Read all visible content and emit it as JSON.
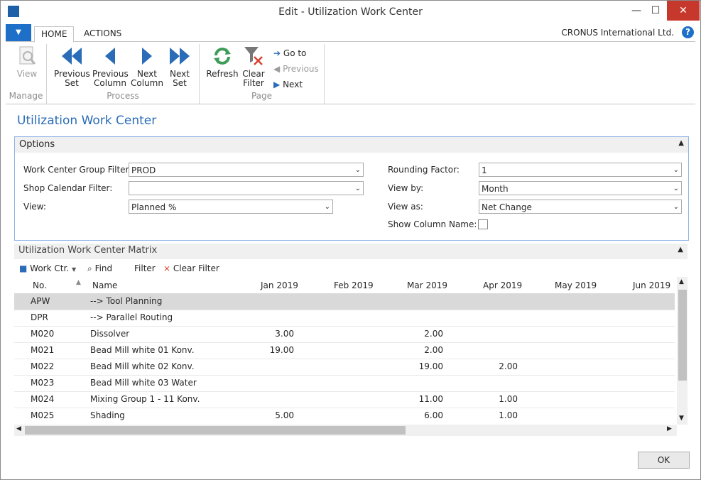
{
  "window": {
    "title": "Edit - Utilization Work Center"
  },
  "ribbon": {
    "tabs": [
      "HOME",
      "ACTIONS"
    ],
    "company": "CRONUS International Ltd.",
    "groups": {
      "manage": "Manage",
      "process": "Process",
      "page": "Page"
    },
    "buttons": {
      "view": "View",
      "prev_set": "Previous\nSet",
      "prev_col": "Previous\nColumn",
      "next_col": "Next\nColumn",
      "next_set": "Next\nSet",
      "refresh": "Refresh",
      "clear_filter": "Clear\nFilter",
      "goto": "Go to",
      "previous": "Previous",
      "next": "Next"
    },
    "accent": "#1e6fc8"
  },
  "page": {
    "title": "Utilization Work Center"
  },
  "options": {
    "header": "Options",
    "wc_group_label": "Work Center Group Filter:",
    "wc_group_value": "PROD",
    "shop_cal_label": "Shop Calendar Filter:",
    "shop_cal_value": "",
    "view_label": "View:",
    "view_value": "Planned %",
    "rounding_label": "Rounding Factor:",
    "rounding_value": "1",
    "viewby_label": "View by:",
    "viewby_value": "Month",
    "viewas_label": "View as:",
    "viewas_value": "Net Change",
    "showcol_label": "Show Column Name:"
  },
  "matrix": {
    "header": "Utilization Work Center Matrix",
    "toolbar": {
      "work_ctr": "Work Ctr.",
      "find": "Find",
      "filter": "Filter",
      "clear_filter": "Clear Filter"
    },
    "columns": [
      "No.",
      "Name",
      "Jan 2019",
      "Feb 2019",
      "Mar 2019",
      "Apr 2019",
      "May 2019",
      "Jun 2019"
    ],
    "rows": [
      {
        "no": "APW",
        "name": "--> Tool Planning",
        "v": [
          "",
          "",
          "",
          "",
          "",
          ""
        ]
      },
      {
        "no": "DPR",
        "name": "--> Parallel Routing",
        "v": [
          "",
          "",
          "",
          "",
          "",
          ""
        ]
      },
      {
        "no": "M020",
        "name": "Dissolver",
        "v": [
          "3.00",
          "",
          "2.00",
          "",
          "",
          ""
        ]
      },
      {
        "no": "M021",
        "name": "Bead Mill white 01 Konv.",
        "v": [
          "19.00",
          "",
          "2.00",
          "",
          "",
          ""
        ]
      },
      {
        "no": "M022",
        "name": "Bead Mill white 02 Konv.",
        "v": [
          "",
          "",
          "19.00",
          "2.00",
          "",
          ""
        ]
      },
      {
        "no": "M023",
        "name": "Bead Mill white 03 Water",
        "v": [
          "",
          "",
          "",
          "",
          "",
          ""
        ]
      },
      {
        "no": "M024",
        "name": "Mixing Group 1 - 11 Konv.",
        "v": [
          "",
          "",
          "11.00",
          "1.00",
          "",
          ""
        ]
      },
      {
        "no": "M025",
        "name": "Shading",
        "v": [
          "5.00",
          "",
          "6.00",
          "1.00",
          "",
          ""
        ]
      }
    ]
  },
  "footer": {
    "ok": "OK"
  }
}
